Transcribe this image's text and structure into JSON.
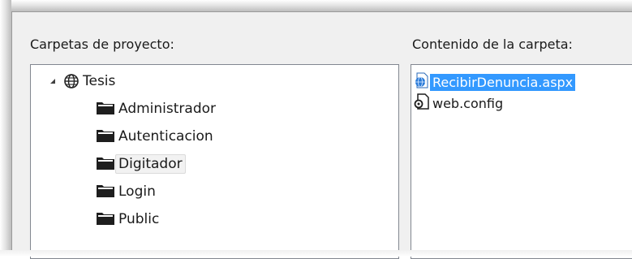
{
  "left_panel": {
    "title": "Carpetas de proyecto:",
    "root": {
      "label": "Tesis",
      "icon": "globe-icon",
      "expanded": true
    },
    "folders": [
      {
        "label": "Administrador",
        "icon": "folder-icon",
        "selected": false
      },
      {
        "label": "Autenticacion",
        "icon": "folder-icon",
        "selected": false
      },
      {
        "label": "Digitador",
        "icon": "folder-icon",
        "selected": true
      },
      {
        "label": "Login",
        "icon": "folder-icon",
        "selected": false
      },
      {
        "label": "Public",
        "icon": "folder-icon",
        "selected": false
      }
    ]
  },
  "right_panel": {
    "title": "Contenido de la carpeta:",
    "files": [
      {
        "label": "RecibirDenuncia.aspx",
        "icon": "aspx-file-icon",
        "selected": true
      },
      {
        "label": "web.config",
        "icon": "config-file-icon",
        "selected": false
      }
    ]
  },
  "colors": {
    "selection": "#3399ff",
    "panel_border": "#828790",
    "background": "#f0f0f0"
  }
}
